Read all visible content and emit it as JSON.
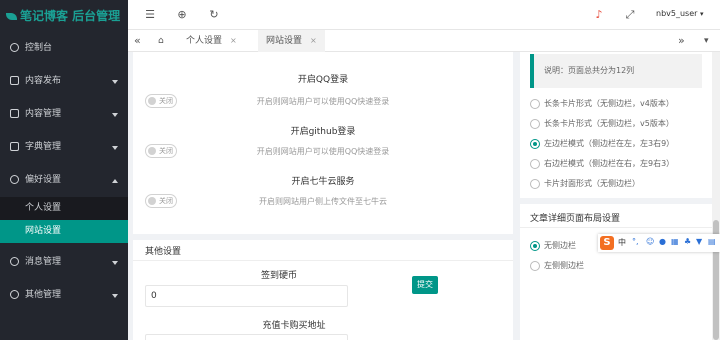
{
  "app": {
    "logo_text": "笔记博客 后台管理"
  },
  "sidebar": {
    "items": [
      {
        "label": "控制台"
      },
      {
        "label": "内容发布"
      },
      {
        "label": "内容管理"
      },
      {
        "label": "字典管理"
      },
      {
        "label": "偏好设置"
      },
      {
        "label": "消息管理"
      },
      {
        "label": "其他管理"
      }
    ],
    "sub_items": [
      {
        "label": "个人设置"
      },
      {
        "label": "网站设置"
      }
    ]
  },
  "topbar": {
    "user_name": "nbv5_user"
  },
  "tabs": [
    {
      "label": "个人设置",
      "close": "×"
    },
    {
      "label": "网站设置",
      "close": "×"
    }
  ],
  "qq_login": {
    "title": "开启QQ登录",
    "switch_label": "关闭",
    "hint": "开启则网站用户可以使用QQ快速登录"
  },
  "github_login": {
    "title": "开启github登录",
    "switch_label": "关闭",
    "hint": "开启则网站用户可以使用QQ快速登录"
  },
  "qiniu": {
    "title": "开启七牛云服务",
    "switch_label": "关闭",
    "hint": "开启则网站用户侧上传文件至七牛云"
  },
  "other": {
    "section_title": "其他设置",
    "checkin_label": "签到硬币",
    "checkin_value": "0",
    "submit_label": "提交",
    "recharge_label": "充值卡购买地址"
  },
  "layout": {
    "note": "说明：页面总共分为12列",
    "list_options": [
      {
        "label": "长条卡片形式（无侧边栏，v4版本）",
        "checked": false
      },
      {
        "label": "长条卡片形式（无侧边栏，v5版本）",
        "checked": false
      },
      {
        "label": "左边栏模式（侧边栏在左，左3右9）",
        "checked": true
      },
      {
        "label": "右边栏模式（侧边栏在右，左9右3）",
        "checked": false
      },
      {
        "label": "卡片封面形式（无侧边栏）",
        "checked": false
      }
    ],
    "detail_title": "文章详细页面布局设置",
    "detail_options": [
      {
        "label": "无侧边栏",
        "checked": true
      },
      {
        "label": "左侧侧边栏",
        "checked": false
      }
    ]
  },
  "ime": {
    "logo": "S",
    "lang": "中"
  },
  "colors": {
    "accent": "#009688",
    "sidebar_bg": "#23262e",
    "logo": "#1aa094"
  }
}
